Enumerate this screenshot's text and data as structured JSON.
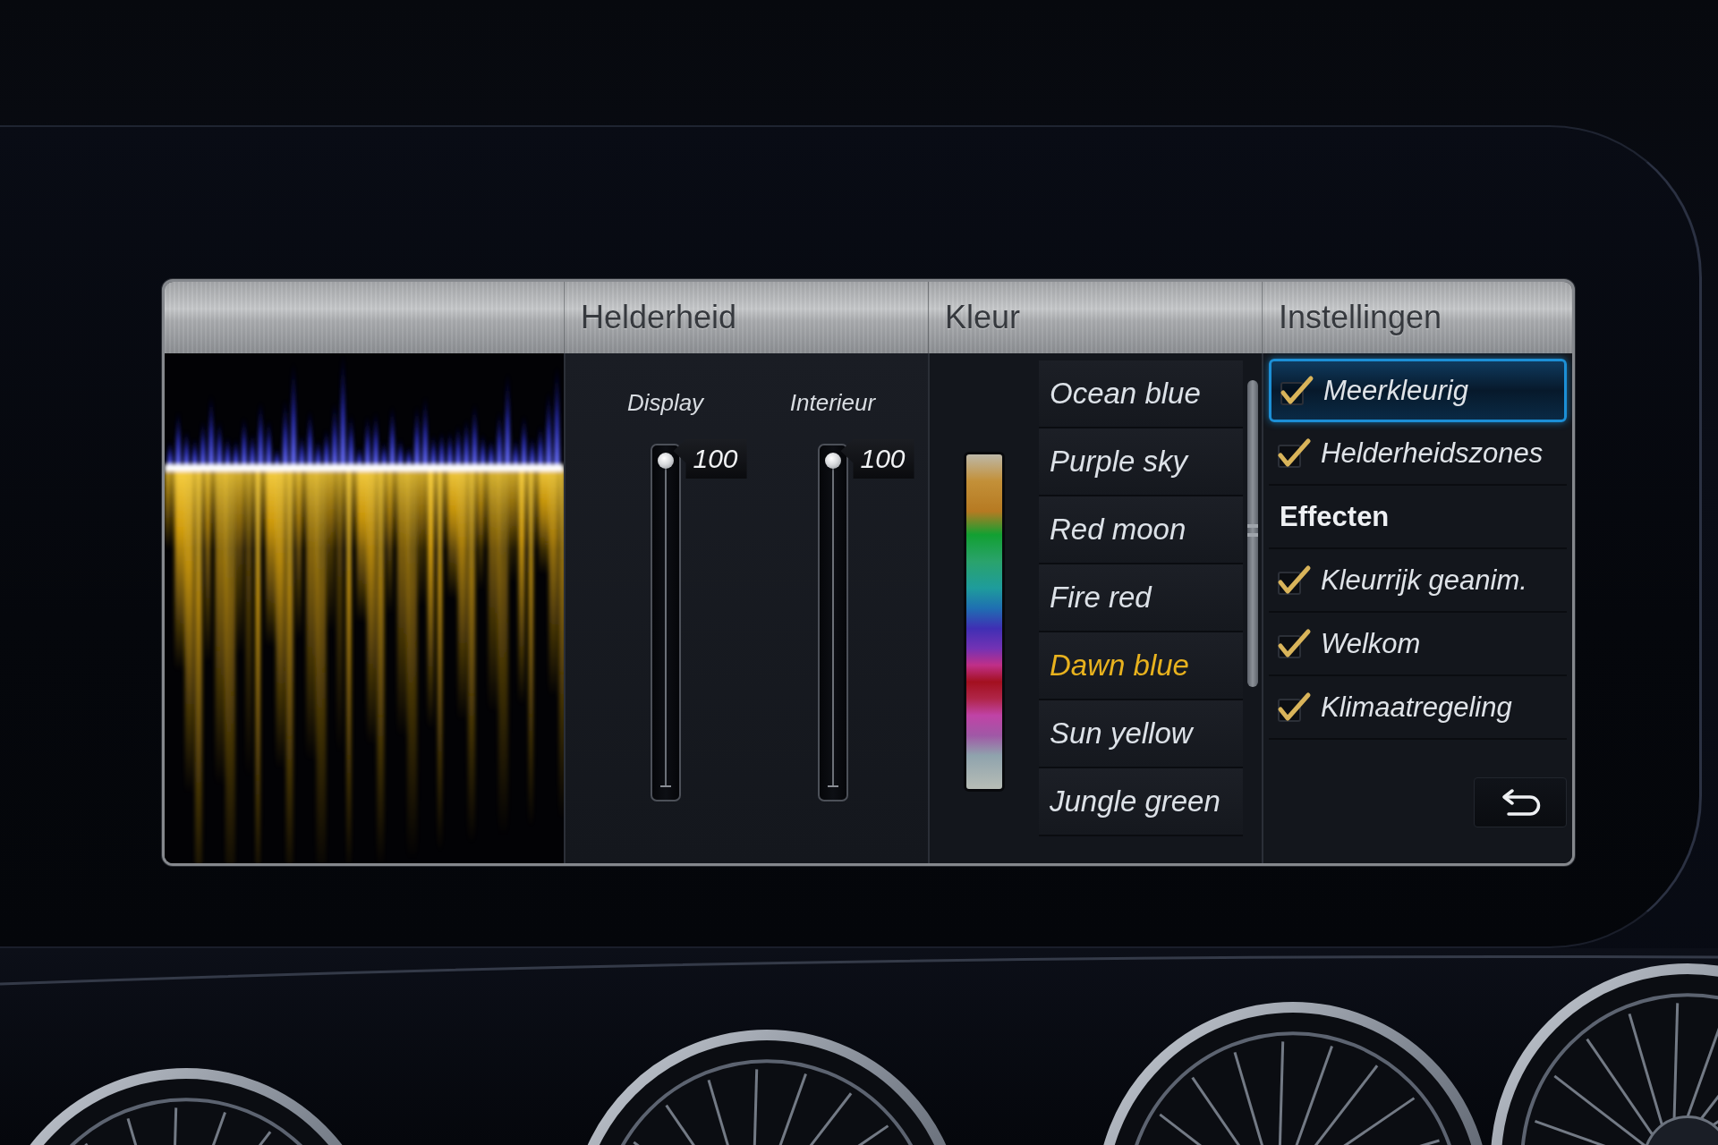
{
  "brightness": {
    "title": "Helderheid",
    "sliders": [
      {
        "label": "Display",
        "level": 1,
        "reading": "100"
      },
      {
        "label": "Interieur",
        "level": 1,
        "reading": "100"
      }
    ]
  },
  "color": {
    "title": "Kleur",
    "options": [
      {
        "label": "Ocean blue",
        "selected": false
      },
      {
        "label": "Purple sky",
        "selected": false
      },
      {
        "label": "Red moon",
        "selected": false
      },
      {
        "label": "Fire red",
        "selected": false
      },
      {
        "label": "Dawn blue",
        "selected": true
      },
      {
        "label": "Sun yellow",
        "selected": false
      },
      {
        "label": "Jungle green",
        "selected": false
      }
    ]
  },
  "settings": {
    "title": "Instellingen",
    "items": [
      {
        "kind": "checkbox",
        "label": "Meerkleurig",
        "checked": true,
        "focused": true
      },
      {
        "kind": "checkbox",
        "label": "Helderheidszones",
        "checked": true,
        "focused": false
      },
      {
        "kind": "heading",
        "label": "Effecten",
        "focused": false
      },
      {
        "kind": "checkbox",
        "label": "Kleurrijk geanim.",
        "checked": true,
        "focused": false
      },
      {
        "kind": "checkbox",
        "label": "Welkom",
        "checked": true,
        "focused": false
      },
      {
        "kind": "checkbox",
        "label": "Klimaatregeling",
        "checked": true,
        "focused": false
      }
    ]
  }
}
